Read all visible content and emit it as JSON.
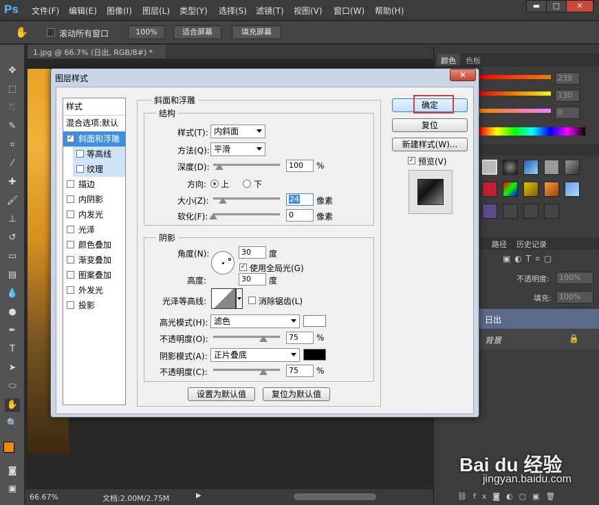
{
  "app": {
    "logo": "Ps"
  },
  "menu": [
    "文件(F)",
    "编辑(E)",
    "图像(I)",
    "图层(L)",
    "类型(Y)",
    "选择(S)",
    "滤镜(T)",
    "视图(V)",
    "窗口(W)",
    "帮助(H)"
  ],
  "window_controls": {
    "minimize": "▬",
    "maximize": "□",
    "close": "✕"
  },
  "options": {
    "scroll_all_label": "滚动所有窗口",
    "zoom_100": "100%",
    "fit_screen": "适合屏幕",
    "fill_screen": "填充屏幕"
  },
  "document_tab": {
    "title": "1.jpg @ 66.7% (日出, RGB/8#) *",
    "close": "×"
  },
  "status": {
    "zoom": "66.67%",
    "doc_size": "文档:2.00M/2.75M"
  },
  "color_panel": {
    "tabs": [
      "颜色",
      "色板"
    ],
    "values": [
      "239",
      "130",
      "0"
    ]
  },
  "layers_panel": {
    "tabs": [
      "路径",
      "历史记录"
    ],
    "opacity_label": "不透明度:",
    "opacity_value": "100%",
    "fill_label": "填充:",
    "fill_value": "100%",
    "layers": [
      "日出",
      "背景"
    ]
  },
  "dialog": {
    "title": "图层样式",
    "close": "✕",
    "styles_header": "样式",
    "blend_options": "混合选项:默认",
    "style_items": [
      {
        "label": "斜面和浮雕",
        "checked": true
      },
      {
        "label": "等高线",
        "checked": false
      },
      {
        "label": "纹理",
        "checked": false
      },
      {
        "label": "描边",
        "checked": false
      },
      {
        "label": "内阴影",
        "checked": false
      },
      {
        "label": "内发光",
        "checked": false
      },
      {
        "label": "光泽",
        "checked": false
      },
      {
        "label": "颜色叠加",
        "checked": false
      },
      {
        "label": "渐变叠加",
        "checked": false
      },
      {
        "label": "图案叠加",
        "checked": false
      },
      {
        "label": "外发光",
        "checked": false
      },
      {
        "label": "投影",
        "checked": false
      }
    ],
    "bevel": {
      "title": "斜面和浮雕",
      "structure_title": "结构",
      "style_label": "样式(T):",
      "style_value": "内斜面",
      "method_label": "方法(Q):",
      "method_value": "平滑",
      "depth_label": "深度(D):",
      "depth_value": "100",
      "depth_unit": "%",
      "direction_label": "方向:",
      "direction_up": "上",
      "direction_down": "下",
      "size_label": "大小(Z):",
      "size_value": "24",
      "size_unit": "像素",
      "soften_label": "软化(F):",
      "soften_value": "0",
      "soften_unit": "像素"
    },
    "shading": {
      "title": "阴影",
      "angle_label": "角度(N):",
      "angle_value": "30",
      "angle_unit": "度",
      "global_light": "使用全局光(G)",
      "altitude_label": "高度:",
      "altitude_value": "30",
      "altitude_unit": "度",
      "gloss_contour_label": "光泽等高线:",
      "anti_alias": "消除锯齿(L)",
      "highlight_mode_label": "高光模式(H):",
      "highlight_mode_value": "滤色",
      "highlight_color": "#ffffff",
      "highlight_opacity_label": "不透明度(O):",
      "highlight_opacity_value": "75",
      "shadow_mode_label": "阴影模式(A):",
      "shadow_mode_value": "正片叠底",
      "shadow_color": "#000000",
      "shadow_opacity_label": "不透明度(C):",
      "shadow_opacity_value": "75",
      "percent": "%"
    },
    "make_default": "设置为默认值",
    "reset_default": "复位为默认值",
    "ok": "确定",
    "reset": "复位",
    "new_style": "新建样式(W)...",
    "preview": "预览(V)"
  },
  "watermark": {
    "brand": "Bai du 经验",
    "url": "jingyan.baidu.com"
  }
}
